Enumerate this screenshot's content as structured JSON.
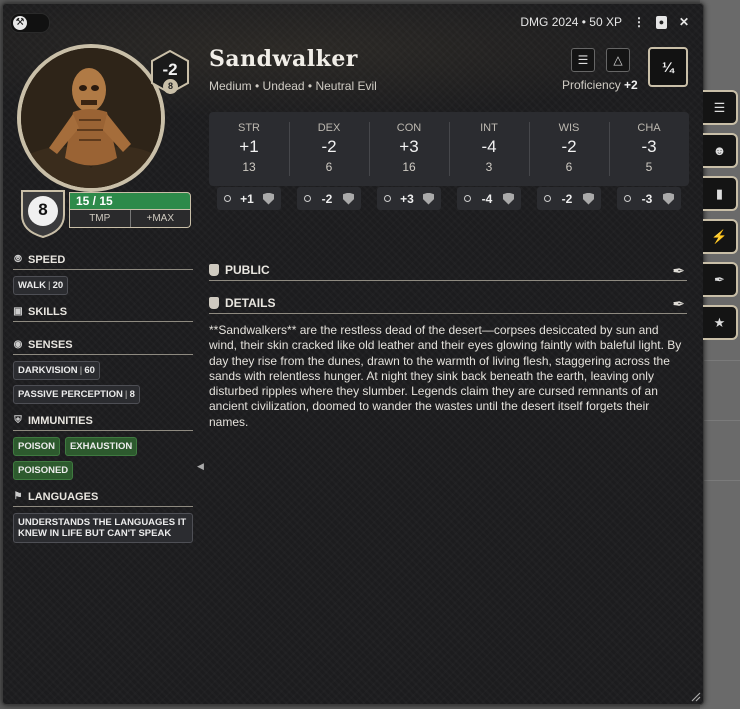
{
  "window": {
    "source": "DMG 2024",
    "xp": "50 XP"
  },
  "creature": {
    "name": "Sandwalker",
    "subtitle": "Medium • Undead • Neutral Evil",
    "cr_mod": "-2",
    "cr_sub": "8",
    "ac": "8",
    "hp": "15 / 15",
    "hp_fraction": 1.0,
    "tmp_label": "TMP",
    "max_label": "+MAX",
    "cr": "¼",
    "proficiency_label": "Proficiency",
    "proficiency_value": "+2"
  },
  "abilities": [
    {
      "label": "STR",
      "mod": "+1",
      "score": "13",
      "save": "+1"
    },
    {
      "label": "DEX",
      "mod": "-2",
      "score": "6",
      "save": "-2"
    },
    {
      "label": "CON",
      "mod": "+3",
      "score": "16",
      "save": "+3"
    },
    {
      "label": "INT",
      "mod": "-4",
      "score": "3",
      "save": "-4"
    },
    {
      "label": "WIS",
      "mod": "-2",
      "score": "6",
      "save": "-2"
    },
    {
      "label": "CHA",
      "mod": "-3",
      "score": "5",
      "save": "-3"
    }
  ],
  "sidebar": {
    "speed": {
      "title": "SPEED",
      "tags": [
        {
          "name": "WALK",
          "value": "20"
        }
      ]
    },
    "skills": {
      "title": "SKILLS"
    },
    "senses": {
      "title": "SENSES",
      "tags": [
        {
          "name": "DARKVISION",
          "value": "60"
        },
        {
          "name": "PASSIVE PERCEPTION",
          "value": "8"
        }
      ]
    },
    "immunities": {
      "title": "IMMUNITIES",
      "tags": [
        "POISON",
        "EXHAUSTION",
        "POISONED"
      ]
    },
    "languages": {
      "title": "LANGUAGES",
      "text": "UNDERSTANDS THE LANGUAGES IT KNEW IN LIFE BUT CAN'T SPEAK"
    }
  },
  "sections": {
    "public": "PUBLIC",
    "details": "DETAILS"
  },
  "description": "**Sandwalkers** are the restless dead of the desert—corpses desiccated by sun and wind, their skin cracked like old leather and their eyes glowing faintly with baleful light. By day they rise from the dunes, drawn to the warmth of living flesh, staggering across the sands with relentless hunger. At night they sink back beneath the earth, leaving only disturbed ripples where they slumber. Legends claim they are cursed remnants of an ancient civilization, doomed to wander the wastes until the desert itself forgets their names.",
  "icons": {
    "toggle": "wrench-icon",
    "menu": "kebab-menu-icon",
    "sheet": "sheet-icon",
    "close": "close-icon",
    "sidetabs": [
      "list-icon",
      "npc-icon",
      "book-icon",
      "lightning-icon",
      "quill-icon",
      "star-icon"
    ]
  }
}
